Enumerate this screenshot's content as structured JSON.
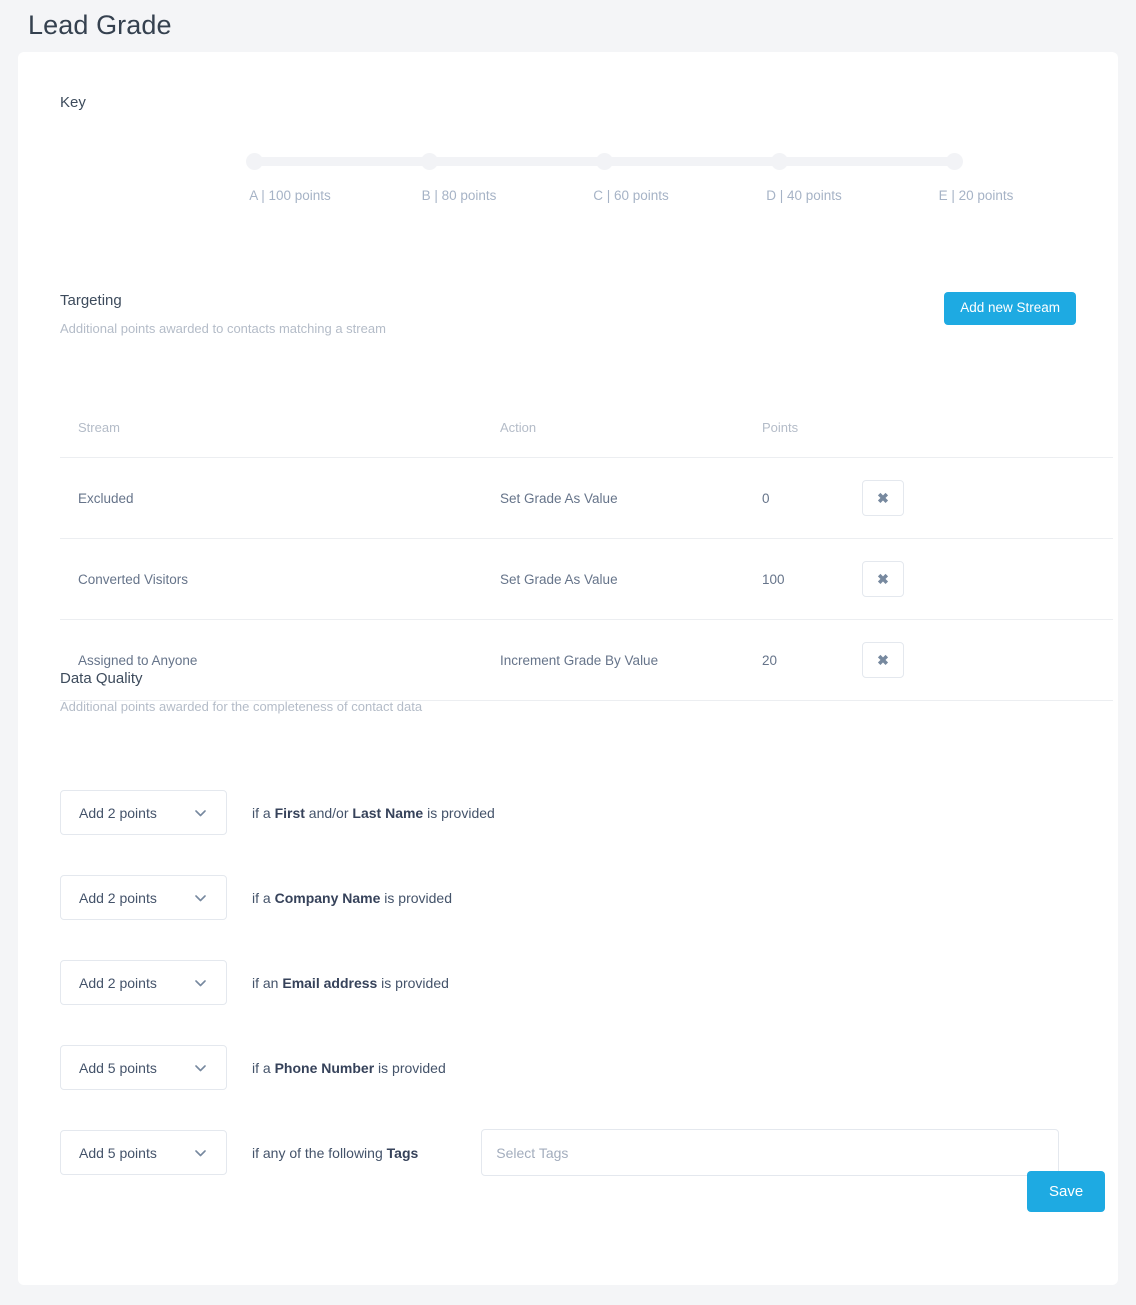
{
  "page": {
    "title": "Lead Grade"
  },
  "key": {
    "label": "Key",
    "stops": [
      {
        "text": "A | 100 points"
      },
      {
        "text": "B | 80 points"
      },
      {
        "text": "C | 60 points"
      },
      {
        "text": "D | 40 points"
      },
      {
        "text": "E | 20 points"
      }
    ]
  },
  "targeting": {
    "title": "Targeting",
    "subtitle": "Additional points awarded to contacts matching a stream",
    "add_button": "Add new Stream",
    "columns": [
      "Stream",
      "Action",
      "Points"
    ],
    "rows": [
      {
        "stream": "Excluded",
        "action": "Set Grade As Value",
        "points": "0",
        "delete": "✖"
      },
      {
        "stream": "Converted Visitors",
        "action": "Set Grade As Value",
        "points": "100",
        "delete": "✖"
      },
      {
        "stream": "Assigned to Anyone",
        "action": "Increment Grade By Value",
        "points": "20",
        "delete": "✖"
      }
    ]
  },
  "data_quality": {
    "title": "Data Quality",
    "subtitle": "Additional points awarded for the completeness of contact data",
    "rows": [
      {
        "select_value": "Add 2 points",
        "desc_prefix": "if a ",
        "desc_bold1": "First",
        "desc_mid": " and/or ",
        "desc_bold2": "Last Name",
        "desc_suffix": " is provided"
      },
      {
        "select_value": "Add 2 points",
        "desc_prefix": "if a ",
        "desc_bold1": "Company Name",
        "desc_mid": "",
        "desc_bold2": "",
        "desc_suffix": " is provided"
      },
      {
        "select_value": "Add 2 points",
        "desc_prefix": "if an ",
        "desc_bold1": "Email address",
        "desc_mid": "",
        "desc_bold2": "",
        "desc_suffix": " is provided"
      },
      {
        "select_value": "Add 5 points",
        "desc_prefix": "if a ",
        "desc_bold1": "Phone Number",
        "desc_mid": "",
        "desc_bold2": "",
        "desc_suffix": " is provided"
      },
      {
        "select_value": "Add 5 points",
        "desc_prefix": "if any of the following ",
        "desc_bold1": "Tags",
        "desc_mid": "",
        "desc_bold2": "",
        "desc_suffix": ""
      }
    ],
    "tags_placeholder": "Select Tags",
    "tags_value": "",
    "save_button": "Save"
  },
  "colors": {
    "accent": "#1eaae2",
    "page_background": "#f4f5f7",
    "card_background": "#ffffff",
    "muted_text": "#b4bcc8",
    "slider_track": "#f2f3f6"
  }
}
